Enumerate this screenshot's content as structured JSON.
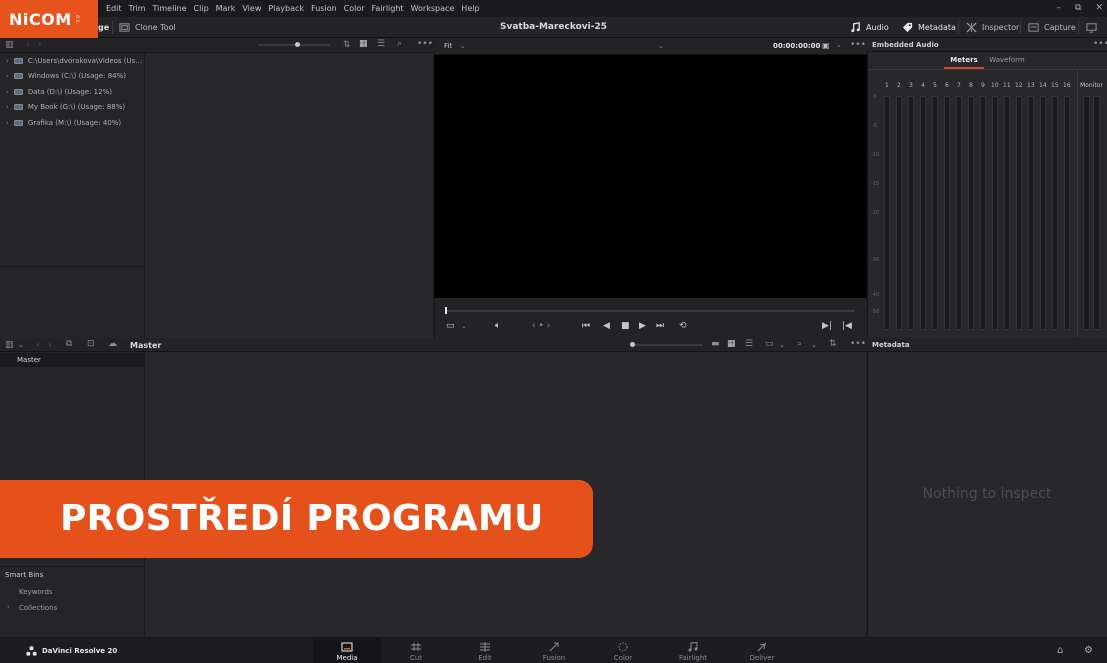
{
  "logo": {
    "text": "NiCOM",
    "sub": "a.s."
  },
  "menubar": {
    "items": [
      "Edit",
      "Trim",
      "Timeline",
      "Clip",
      "Mark",
      "View",
      "Playback",
      "Fusion",
      "Color",
      "Fairlight",
      "Workspace",
      "Help"
    ]
  },
  "window_controls": {
    "minimize": "–",
    "restore": "⧉",
    "close": "✕"
  },
  "toolbar": {
    "media_stub": "ge",
    "clone_tool": "Clone Tool",
    "project_title": "Svatba-Mareckovi-25",
    "audio": "Audio",
    "metadata": "Metadata",
    "inspector": "Inspector",
    "capture": "Capture"
  },
  "media_storage": {
    "items": [
      "C:\\Users\\dvorakova\\Videos (Us...",
      "Windows (C:\\) (Usage: 84%)",
      "Data (D:\\) (Usage: 12%)",
      "My Book (G:\\) (Usage: 88%)",
      "Grafika (M:\\) (Usage: 40%)"
    ]
  },
  "viewer": {
    "zoom": "Fit",
    "timecode": "00:00:00:00"
  },
  "audio_panel": {
    "title": "Embedded Audio",
    "tabs": [
      "Meters",
      "Waveform"
    ],
    "active_tab": "Meters",
    "channels": [
      "1",
      "2",
      "3",
      "4",
      "5",
      "6",
      "7",
      "8",
      "9",
      "10",
      "11",
      "12",
      "13",
      "14",
      "15",
      "16"
    ],
    "monitor": "Monitor",
    "scale": [
      "0",
      "-5",
      "-10",
      "-15",
      "-20",
      "-30",
      "-40",
      "-50"
    ]
  },
  "media_pool": {
    "bin_title": "Master",
    "bins": [
      "Master"
    ],
    "smart_bins_title": "Smart Bins",
    "smart_bins": [
      "Keywords",
      "Collections"
    ]
  },
  "metadata_panel": {
    "title": "Metadata",
    "empty": "Nothing to inspect"
  },
  "bottom_nav": {
    "app_name": "DaVinci Resolve 20",
    "pages": [
      "Media",
      "Cut",
      "Edit",
      "Fusion",
      "Color",
      "Fairlight",
      "Deliver"
    ],
    "active": "Media"
  },
  "banner": {
    "text": "PROSTŘEDÍ PROGRAMU"
  }
}
